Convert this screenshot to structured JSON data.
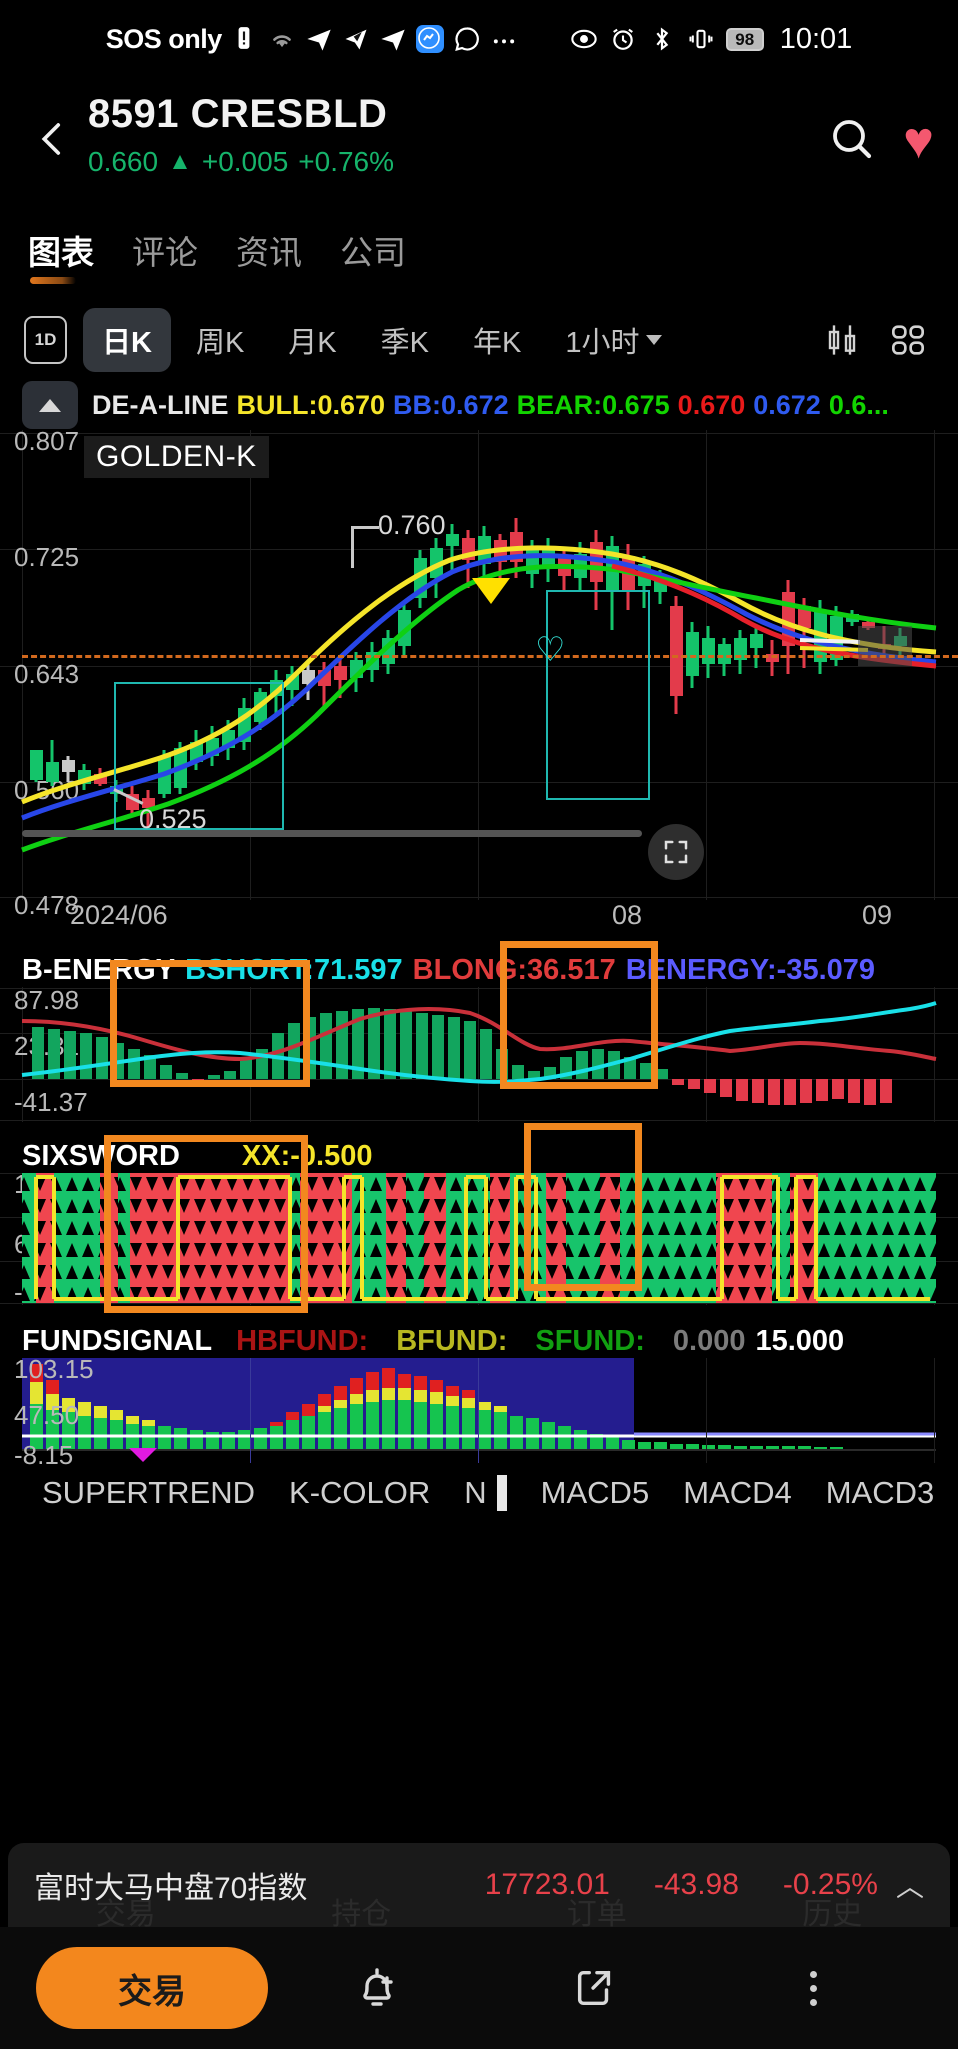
{
  "status_bar": {
    "carrier": "SOS only",
    "icons": [
      "alert-icon",
      "wifi-icon",
      "telegram-icon",
      "app-icon",
      "telegram-icon-2",
      "messenger-icon",
      "whatsapp-icon",
      "more-icon"
    ],
    "right_icons": [
      "eye-icon",
      "alarm-icon",
      "bluetooth-icon",
      "vibrate-icon"
    ],
    "battery": "98",
    "time": "10:01"
  },
  "header": {
    "back": "‹",
    "symbol": "8591  CRESBLD",
    "price": "0.660",
    "arrow": "▲",
    "change": "+0.005",
    "change_pct": "+0.76%",
    "up_color": "#16b46b",
    "search_icon": "search-icon",
    "favorite_icon": "heart-icon"
  },
  "tabs": [
    {
      "label": "图表",
      "active": true
    },
    {
      "label": "评论",
      "active": false
    },
    {
      "label": "资讯",
      "active": false
    },
    {
      "label": "公司",
      "active": false
    }
  ],
  "periods": {
    "intraday_badge": "1D",
    "items": [
      {
        "label": "日K",
        "active": true
      },
      {
        "label": "周K",
        "active": false
      },
      {
        "label": "月K",
        "active": false
      },
      {
        "label": "季K",
        "active": false
      },
      {
        "label": "年K",
        "active": false
      },
      {
        "label": "1小时",
        "active": false,
        "dropdown": true
      }
    ],
    "candle_icon": "candlestick-icon",
    "grid_icon": "grid-layout-icon"
  },
  "main_indicator": {
    "collapse_icon": "collapse-up-icon",
    "name": "DE-A-LINE",
    "fields": [
      {
        "label": "BULL:0.670",
        "color": "#f5e52a"
      },
      {
        "label": "BB:0.672",
        "color": "#2f5bf0"
      },
      {
        "label": "BEAR:0.675",
        "color": "#12d400"
      },
      {
        "label": "0.670",
        "color": "#e81a1a"
      },
      {
        "label": "0.672",
        "color": "#2f5bf0"
      },
      {
        "label": "0.6...",
        "color": "#12d400"
      }
    ],
    "overlay_tag": "GOLDEN-K"
  },
  "chart_data": {
    "type": "line",
    "title": "8591 CRESBLD — 日K",
    "panels": [
      {
        "name": "price",
        "yticks": [
          "0.807",
          "0.725",
          "0.643",
          "0.560",
          "0.478"
        ],
        "ylim": [
          0.478,
          0.807
        ],
        "annotations": [
          {
            "text": "0.760",
            "note": "swing-high callout"
          },
          {
            "text": "0.525",
            "note": "swing-low callout"
          }
        ],
        "reference_line": 0.663,
        "markers": [
          "yellow-down-triangle",
          "teal-heart-outline"
        ],
        "boxes": 2
      },
      {
        "name": "B-ENERGY",
        "legend": [
          {
            "label": "B-ENERGY",
            "color": "#ffffff"
          },
          {
            "label": "BSHORT:71.597",
            "color": "#19e0e8"
          },
          {
            "label": "BLONG:36.517",
            "color": "#e03c3c"
          },
          {
            "label": "BENERGY:-35.079",
            "color": "#5b5bff"
          }
        ],
        "yticks": [
          "87.98",
          "23.31",
          "-41.37"
        ],
        "ylim": [
          -41.37,
          87.98
        ]
      },
      {
        "name": "SIXSWORD",
        "legend": [
          {
            "label": "SIXSWORD",
            "color": "#ffffff"
          },
          {
            "label": "XX:-0.500",
            "color": "#f5e52a"
          }
        ],
        "yticks": [
          "12.89",
          "6.00",
          "-0.89"
        ],
        "ylim": [
          -0.89,
          12.89
        ]
      },
      {
        "name": "FUNDSIGNAL",
        "legend": [
          {
            "label": "FUNDSIGNAL",
            "color": "#ffffff"
          },
          {
            "label": "HBFUND:",
            "color": "#aa1414"
          },
          {
            "label": "BFUND:",
            "color": "#b8b820"
          },
          {
            "label": "SFUND:",
            "color": "#11a011"
          },
          {
            "label": "0.000",
            "color": "#7c7c7c"
          },
          {
            "label": "15.000",
            "color": "#ffffff"
          }
        ],
        "yticks": [
          "103.15",
          "47.50",
          "-8.15"
        ],
        "ylim": [
          -8.15,
          103.15
        ]
      }
    ],
    "xticks": [
      "2024/06",
      "08",
      "09"
    ],
    "xlabel": "",
    "grid": true,
    "legend_position": "top-left"
  },
  "indicator_tabs": [
    {
      "label": "SUPERTREND"
    },
    {
      "label": "K-COLOR"
    },
    {
      "label": "N"
    },
    {
      "label": "MACD5"
    },
    {
      "label": "MACD4"
    },
    {
      "label": "MACD3"
    }
  ],
  "index_bar": {
    "name": "富时大马中盘70指数",
    "value": "17723.01",
    "change": "-43.98",
    "change_pct": "-0.25%",
    "chevron": "︿",
    "down_color": "#e8414a",
    "ghost_items": [
      "交易",
      "持仓",
      "订单",
      "历史"
    ]
  },
  "action_bar": {
    "trade_label": "交易",
    "alert_icon": "bell-plus-icon",
    "share_icon": "share-icon",
    "more_icon": "more-vertical-icon"
  }
}
